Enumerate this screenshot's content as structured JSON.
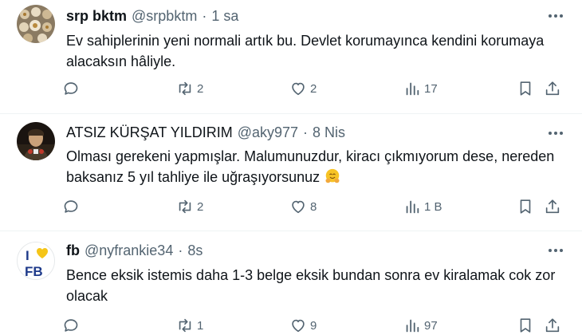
{
  "tweets": [
    {
      "name": "srp bktm",
      "handle": "@srpbktm",
      "dot": "·",
      "time": "1 sa",
      "text": "Ev sahiplerinin yeni normali artık bu.  Devlet korumayınca kendini korumaya alacaksın hâliyle.",
      "retweets": "2",
      "likes": "2",
      "views": "17"
    },
    {
      "name": "ATSIZ KÜRŞAT YILDIRIM",
      "handle": "@aky977",
      "dot": "·",
      "time": "8 Nis",
      "text": "Olması gerekeni yapmışlar. Malumunuzdur, kiracı çıkmıyorum dese, nereden baksanız 5 yıl tahliye ile uğraşıyorsunuz",
      "emoji": "hugging-face-icon",
      "retweets": "2",
      "likes": "8",
      "views": "1 B"
    },
    {
      "name": "fb",
      "handle": "@nyfrankie34",
      "dot": "·",
      "time": "8s",
      "text": "Bence eksik istemis daha 1-3 belge eksik bundan sonra ev kiralamak cok zor olacak",
      "avatar_text_top": "I",
      "avatar_text_bottom": "FB",
      "retweets": "1",
      "likes": "9",
      "views": "97"
    }
  ],
  "colors": {
    "text": "#0f1419",
    "secondary": "#536471",
    "divider": "#eff3f4",
    "heart_avatar": "#f5c518",
    "fb_blue": "#1e3a8a"
  }
}
